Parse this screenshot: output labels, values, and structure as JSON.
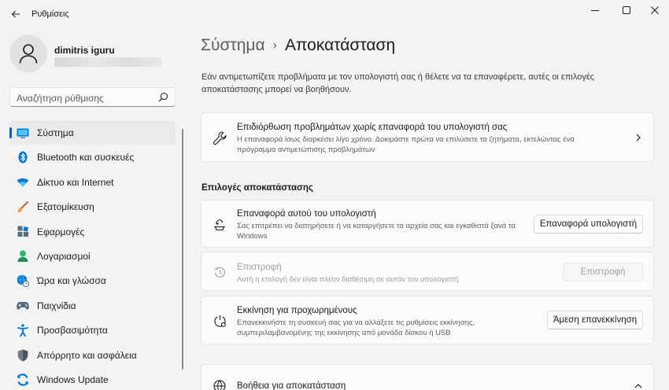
{
  "window": {
    "app_title": "Ρυθμίσεις"
  },
  "profile": {
    "name": "dimitris iguru"
  },
  "search": {
    "placeholder": "Αναζήτηση ρύθμισης"
  },
  "sidebar": {
    "items": [
      {
        "label": "Σύστημα",
        "icon": "system-icon",
        "active": true
      },
      {
        "label": "Bluetooth και συσκευές",
        "icon": "bluetooth-icon"
      },
      {
        "label": "Δίκτυο και Internet",
        "icon": "wifi-icon"
      },
      {
        "label": "Εξατομίκευση",
        "icon": "brush-icon"
      },
      {
        "label": "Εφαρμογές",
        "icon": "apps-icon"
      },
      {
        "label": "Λογαριασμοί",
        "icon": "account-icon"
      },
      {
        "label": "Ώρα και γλώσσα",
        "icon": "globe-clock-icon"
      },
      {
        "label": "Παιχνίδια",
        "icon": "gamepad-icon"
      },
      {
        "label": "Προσβασιμότητα",
        "icon": "accessibility-icon"
      },
      {
        "label": "Απόρρητο και ασφάλεια",
        "icon": "shield-icon"
      },
      {
        "label": "Windows Update",
        "icon": "update-icon"
      }
    ]
  },
  "breadcrumb": {
    "parent": "Σύστημα",
    "separator": "›",
    "current": "Αποκατάσταση"
  },
  "intro": "Εάν αντιμετωπίζετε προβλήματα με τον υπολογιστή σας ή θέλετε να τα επαναφέρετε, αυτές οι επιλογές αποκατάστασης μπορεί να βοηθήσουν.",
  "fix_card": {
    "title": "Επιδιόρθωση προβλημάτων χωρίς επαναφορά του υπολογιστή σας",
    "desc": "Η επαναφορά ίσως διαρκέσει λίγο χρόνο. Δοκιμάστε πρώτα να επιλύσετε τα ζητήματα, εκτελώντας ένα πρόγραμμα αντιμετώπισης προβλημάτων"
  },
  "section": {
    "title": "Επιλογές αποκατάστασης"
  },
  "reset_card": {
    "title": "Επαναφορά αυτού του υπολογιστή",
    "desc": "Σας επιτρέπει να διατηρήσετε ή να καταργήσετε τα αρχεία σας και εγκαθιστά ξανά τα Windows",
    "button": "Επαναφορά υπολογιστή"
  },
  "goback_card": {
    "title": "Επιστροφή",
    "desc": "Αυτή η επιλογή δεν είναι πλέον διαθέσιμη σε αυτόν τον υπολογιστή",
    "button": "Επιστροφή"
  },
  "advanced_card": {
    "title": "Εκκίνηση για προχωρημένους",
    "desc": "Επανεκκινήστε τη συσκευή σας για να αλλάξετε τις ρυθμίσεις εκκίνησης, συμπεριλαμβανομένης της εκκίνησης από μονάδα δίσκου ή USB",
    "button": "Άμεση επανεκκίνηση"
  },
  "help_card": {
    "title": "Βοήθεια για αποκατάσταση"
  },
  "colors": {
    "accent": "#005fb8",
    "background": "#f3f3f3",
    "card": "#fbfbfb"
  }
}
